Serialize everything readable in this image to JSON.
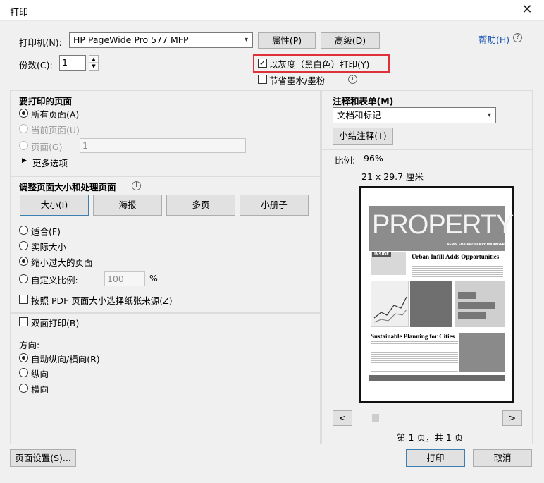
{
  "window": {
    "title": "打印",
    "close_glyph": "✕"
  },
  "printer": {
    "label": "打印机(N):",
    "value": "HP PageWide Pro 577 MFP",
    "properties_button": "属性(P)",
    "advanced_button": "高级(D)",
    "help_link": "帮助(H)"
  },
  "copies": {
    "label": "份数(C):",
    "value": "1"
  },
  "options": {
    "grayscale": {
      "label": "以灰度（黑白色）打印(Y)",
      "checked": true
    },
    "save_ink": {
      "label": "节省墨水/墨粉",
      "checked": false
    }
  },
  "pages_to_print": {
    "heading": "要打印的页面",
    "all": "所有页面(A)",
    "current": "当前页面(U)",
    "pages": "页面(G)",
    "pages_value": "1",
    "more_options": "更多选项"
  },
  "page_sizing": {
    "heading": "调整页面大小和处理页面",
    "tabs": [
      "大小(I)",
      "海报",
      "多页",
      "小册子"
    ],
    "fit": "适合(F)",
    "actual_size": "实际大小",
    "shrink_oversized": "缩小过大的页面",
    "custom_scale": "自定义比例:",
    "custom_scale_value": "100",
    "percent": "%",
    "choose_paper_source": "按照 PDF 页面大小选择纸张来源(Z)"
  },
  "duplex": {
    "label": "双面打印(B)"
  },
  "orientation": {
    "heading": "方向:",
    "auto": "自动纵向/横向(R)",
    "portrait": "纵向",
    "landscape": "横向"
  },
  "comments_forms": {
    "heading": "注释和表单(M)",
    "value": "文档和标记",
    "summarize_button": "小结注释(T)"
  },
  "preview": {
    "scale_label": "比例:",
    "scale_value": "96%",
    "paper_size": "21 x 29.7 厘米",
    "page_indicator": "第 1 页，共 1 页",
    "prev": "<",
    "next": ">",
    "doc": {
      "masthead": "PROPERTY",
      "masthead_sub": "NEWS FOR PROPERTY MANAGERS",
      "inside": "INSIDE",
      "headline1": "Urban Infill Adds Opportunities",
      "headline2": "Sustainable Planning for Cities"
    }
  },
  "footer": {
    "page_setup_button": "页面设置(S)...",
    "print_button": "打印",
    "cancel_button": "取消"
  },
  "colors": {
    "highlight": "#e0303a",
    "link": "#1a55b8",
    "button_focus": "#3c7fb1"
  }
}
